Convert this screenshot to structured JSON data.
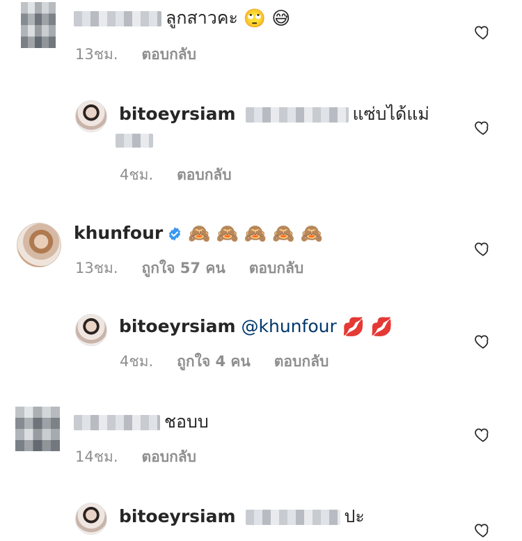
{
  "comments": [
    {
      "username_blurred": true,
      "text": "ลูกสาวคะ",
      "emoji": [
        "🙄",
        "😅"
      ],
      "time": "13ชม.",
      "reply_label": "ตอบกลับ"
    },
    {
      "username": "bitoeyrsiam",
      "mention_blurred": true,
      "text": "แซ่บได้แม่",
      "time": "4ชม.",
      "reply_label": "ตอบกลับ"
    },
    {
      "username": "khunfour",
      "verified": true,
      "emoji": [
        "🙈",
        "🙈",
        "🙈",
        "🙈",
        "🙈"
      ],
      "time": "13ชม.",
      "likes": "ถูกใจ 57 คน",
      "reply_label": "ตอบกลับ"
    },
    {
      "username": "bitoeyrsiam",
      "mention": "@khunfour",
      "emoji": [
        "💋",
        "💋"
      ],
      "time": "4ชม.",
      "likes": "ถูกใจ 4 คน",
      "reply_label": "ตอบกลับ"
    },
    {
      "username_blurred": true,
      "text": "ชอบบ",
      "time": "14ชม.",
      "reply_label": "ตอบกลับ"
    },
    {
      "username": "bitoeyrsiam",
      "mention_blurred": true,
      "text": "ปะ"
    }
  ],
  "icons": {
    "like": "heart-outline-icon",
    "verified": "verified-badge-icon"
  },
  "colors": {
    "meta": "#8e8e8e",
    "mention": "#00376b",
    "verified": "#3897f0"
  }
}
